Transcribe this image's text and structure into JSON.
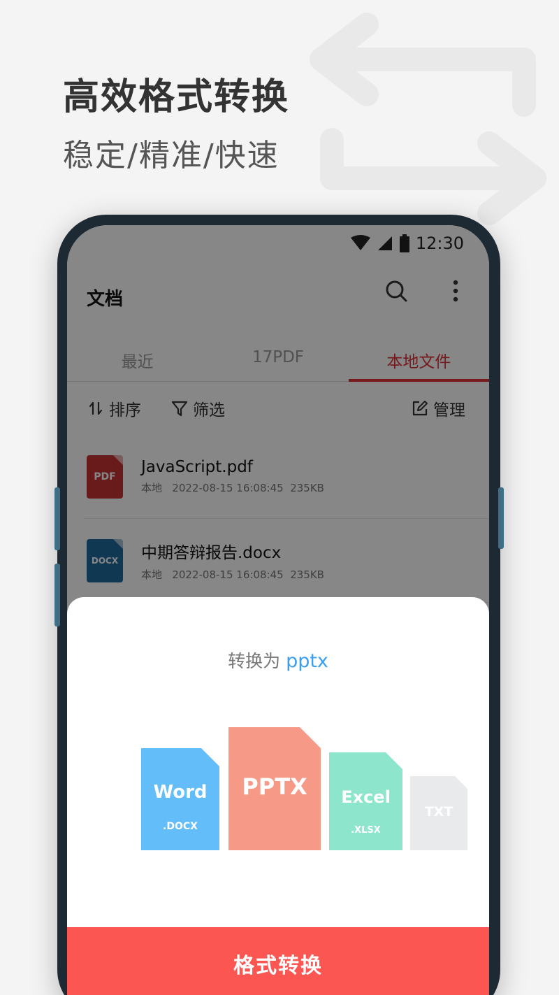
{
  "promo": {
    "headline": "高效格式转换",
    "subline": "稳定/精准/快速"
  },
  "statusbar": {
    "time": "12:30"
  },
  "appbar": {
    "title": "文档",
    "search_icon": "search-icon",
    "more_icon": "more-vertical-icon"
  },
  "tabs": [
    {
      "label": "最近"
    },
    {
      "label": "17PDF"
    },
    {
      "label": "本地文件",
      "active": true
    }
  ],
  "toolbar": {
    "sort_label": "排序",
    "filter_label": "筛选",
    "manage_label": "管理"
  },
  "files": [
    {
      "type": "PDF",
      "name": "JavaScript.pdf",
      "location": "本地",
      "datetime": "2022-08-15 16:08:45",
      "size": "235KB",
      "color": "#c63434"
    },
    {
      "type": "DOCX",
      "name": "中期答辩报告.docx",
      "location": "本地",
      "datetime": "2022-08-15 16:08:45",
      "size": "235KB",
      "color": "#1f6a9c"
    }
  ],
  "sheet": {
    "convert_prefix": "转换为",
    "target_format": "pptx",
    "formats": [
      {
        "main": "Word",
        "sub": ".DOCX",
        "color": "#63bdf9"
      },
      {
        "main": "PPTX",
        "sub": "",
        "color": "#f69986"
      },
      {
        "main": "Excel",
        "sub": ".XLSX",
        "color": "#8de6cb"
      },
      {
        "main": "TXT",
        "sub": "",
        "color": "#e8eaec"
      }
    ],
    "button_label": "格式转换"
  },
  "colors": {
    "accent_red": "#e0313a",
    "button_red": "#fc5653",
    "link_blue": "#3a9ff0"
  }
}
